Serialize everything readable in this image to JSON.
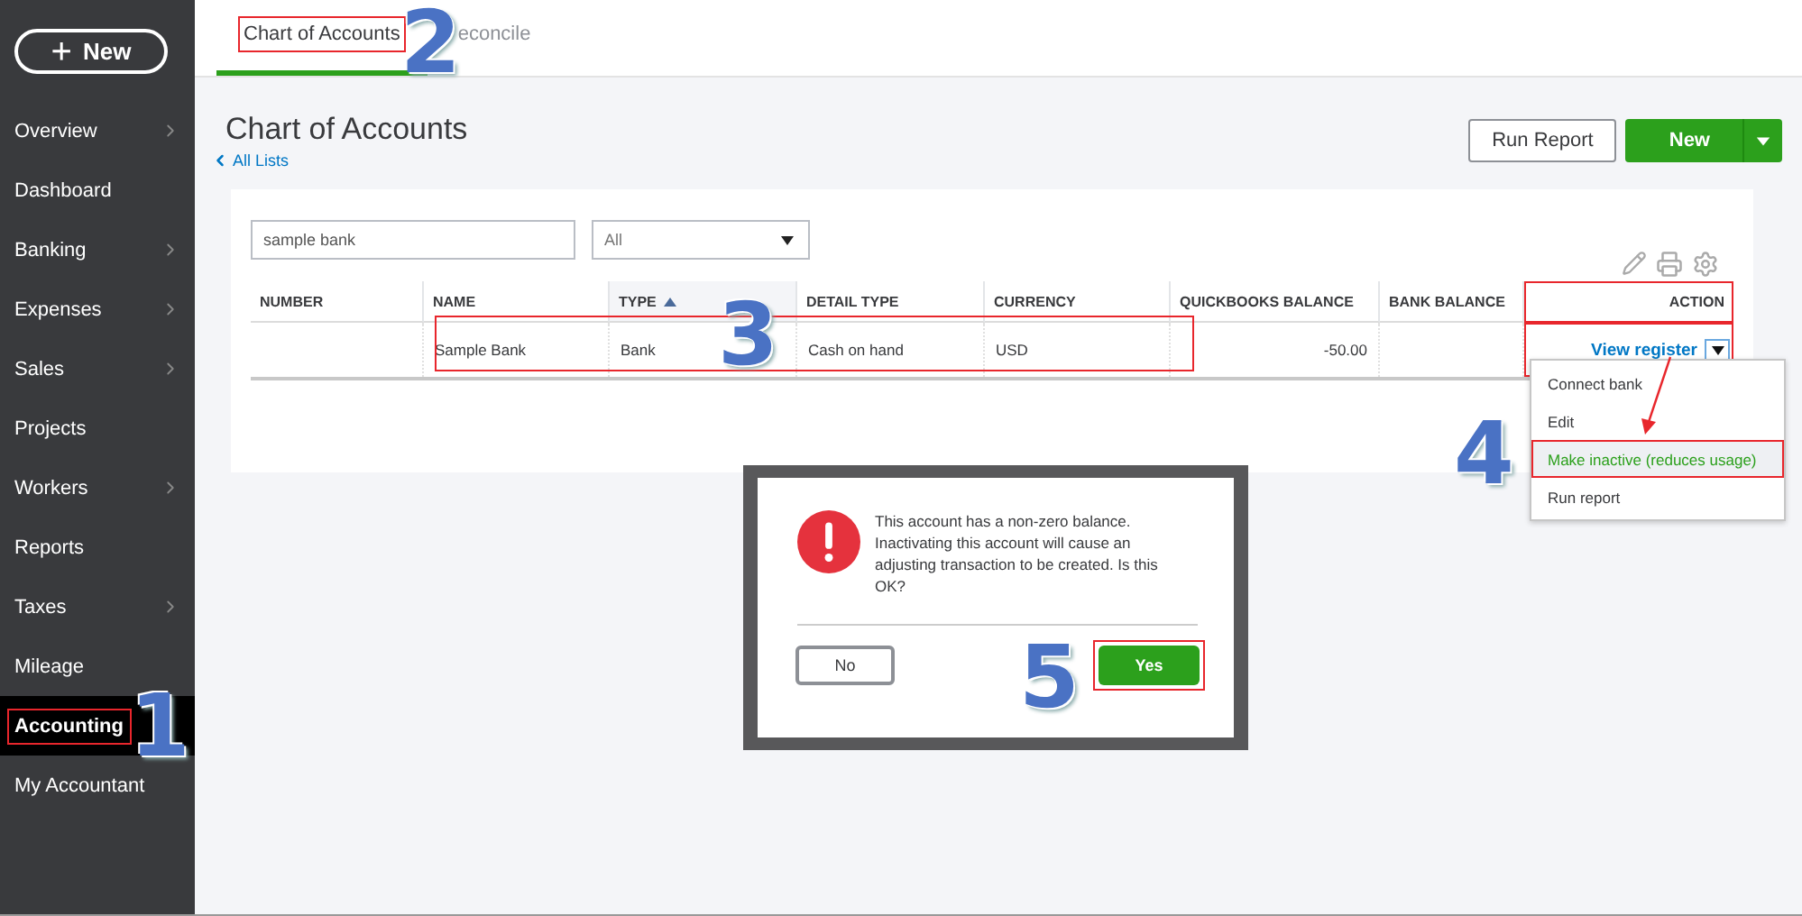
{
  "sidebar": {
    "new_button": {
      "icon": "+",
      "label": "New"
    },
    "items": [
      {
        "label": "Overview",
        "chevron": true,
        "selected": false,
        "highlighted": false
      },
      {
        "label": "Dashboard",
        "chevron": false,
        "selected": false,
        "highlighted": false
      },
      {
        "label": "Banking",
        "chevron": true,
        "selected": false,
        "highlighted": false
      },
      {
        "label": "Expenses",
        "chevron": true,
        "selected": false,
        "highlighted": false
      },
      {
        "label": "Sales",
        "chevron": true,
        "selected": false,
        "highlighted": false
      },
      {
        "label": "Projects",
        "chevron": false,
        "selected": false,
        "highlighted": false
      },
      {
        "label": "Workers",
        "chevron": true,
        "selected": false,
        "highlighted": false
      },
      {
        "label": "Reports",
        "chevron": false,
        "selected": false,
        "highlighted": false
      },
      {
        "label": "Taxes",
        "chevron": true,
        "selected": false,
        "highlighted": false
      },
      {
        "label": "Mileage",
        "chevron": false,
        "selected": false,
        "highlighted": false
      },
      {
        "label": "Accounting",
        "chevron": false,
        "selected": true,
        "highlighted": true
      },
      {
        "label": "My Accountant",
        "chevron": false,
        "selected": false,
        "highlighted": false
      }
    ]
  },
  "tabs": [
    {
      "label": "Chart of Accounts",
      "selected": true,
      "highlighted": true
    },
    {
      "label": "econcile",
      "selected": false,
      "highlighted": false
    }
  ],
  "page": {
    "title": "Chart of Accounts",
    "back_link": "All Lists",
    "run_report_button": "Run Report",
    "new_button": "New"
  },
  "filters": {
    "search_value": "sample bank",
    "type_select": "All"
  },
  "table": {
    "columns": [
      {
        "label": "NUMBER",
        "sorted": false
      },
      {
        "label": "NAME",
        "sorted": false
      },
      {
        "label": "TYPE",
        "sorted": true
      },
      {
        "label": "DETAIL TYPE",
        "sorted": false
      },
      {
        "label": "CURRENCY",
        "sorted": false
      },
      {
        "label": "QUICKBOOKS BALANCE",
        "sorted": false
      },
      {
        "label": "BANK BALANCE",
        "sorted": false
      },
      {
        "label": "ACTION",
        "sorted": false,
        "highlighted": true
      }
    ],
    "rows": [
      {
        "name": "Sample Bank",
        "type": "Bank",
        "detail_type": "Cash on hand",
        "currency": "USD",
        "quickbooks_balance": "-50.00",
        "action_link": "View register",
        "highlighted": true
      }
    ]
  },
  "action_menu": {
    "items": [
      {
        "label": "Connect bank",
        "highlighted": false
      },
      {
        "label": "Edit",
        "highlighted": false
      },
      {
        "label": "Make inactive (reduces usage)",
        "highlighted": true
      },
      {
        "label": "Run report",
        "highlighted": false
      }
    ]
  },
  "dialog": {
    "message": "This account has a non-zero balance. Inactivating this account will cause an adjusting transaction to be created. Is this OK?",
    "buttons": [
      {
        "label": "No",
        "primary": false,
        "highlighted": false
      },
      {
        "label": "Yes",
        "primary": true,
        "highlighted": true
      }
    ]
  },
  "step_numbers": [
    "1",
    "2",
    "3",
    "4",
    "5"
  ]
}
